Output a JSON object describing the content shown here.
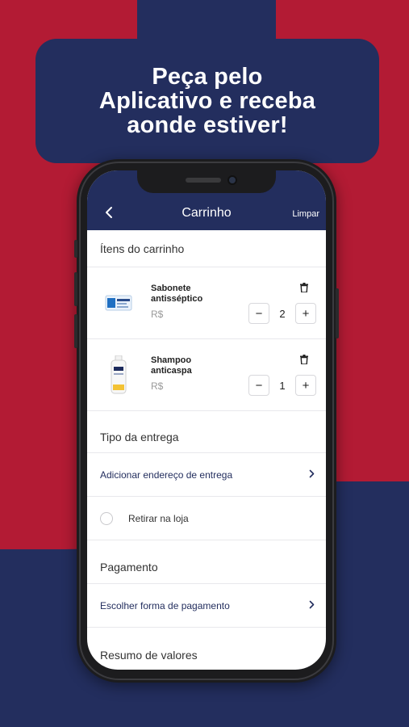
{
  "banner": {
    "line1": "Peça pelo",
    "line2": "Aplicativo e receba",
    "line3": "aonde estiver!"
  },
  "header": {
    "back_icon": "chevron-left-icon",
    "title": "Carrinho",
    "clear_label": "Limpar"
  },
  "cart": {
    "section_title": "Ítens do carrinho",
    "items": [
      {
        "name": "Sabonete antisséptico",
        "price": "R$",
        "quantity": "2",
        "image": "soap-box"
      },
      {
        "name": "Shampoo anticaspa",
        "price": "R$",
        "quantity": "1",
        "image": "shampoo-bottle"
      }
    ],
    "minus": "−",
    "plus": "+"
  },
  "delivery": {
    "section_title": "Tipo da entrega",
    "add_address": "Adicionar endereço de entrega",
    "pickup": "Retirar na loja"
  },
  "payment": {
    "section_title": "Pagamento",
    "choose": "Escolher forma de pagamento"
  },
  "summary": {
    "section_title": "Resumo de valores"
  },
  "colors": {
    "brand_red": "#b31b34",
    "brand_navy": "#232e5e"
  }
}
